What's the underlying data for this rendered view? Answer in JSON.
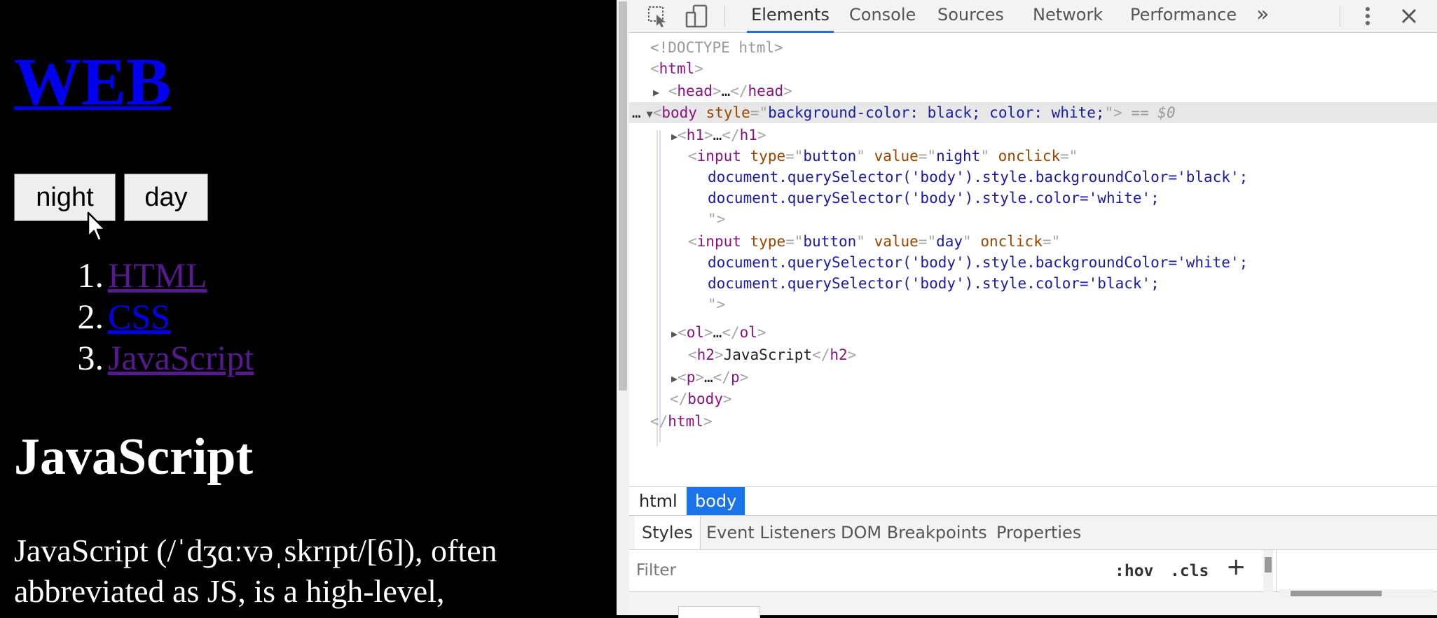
{
  "page": {
    "heading": "WEB",
    "buttons": {
      "night": "night",
      "day": "day"
    },
    "list": [
      {
        "num": "1.",
        "label": "HTML"
      },
      {
        "num": "2.",
        "label": "CSS"
      },
      {
        "num": "3.",
        "label": "JavaScript"
      }
    ],
    "subheading": "JavaScript",
    "paragraph": "JavaScript (/ˈdʒɑːvəˌskrɪpt/[6]), often abbreviated as JS, is a high-level,"
  },
  "devtools": {
    "tabs": [
      "Elements",
      "Console",
      "Sources",
      "Network",
      "Performance"
    ],
    "more": "»",
    "dom": {
      "doctype": "<!DOCTYPE html>",
      "sel_marker": "== $0",
      "body_style": "background-color: black; color: white;",
      "onclick_night_1": "document.querySelector('body').style.backgroundColor='black';",
      "onclick_night_2": "document.querySelector('body').style.color='white';",
      "onclick_day_1": "document.querySelector('body').style.backgroundColor='white';",
      "onclick_day_2": "document.querySelector('body').style.color='black';",
      "h2_text": "JavaScript"
    },
    "breadcrumbs": [
      "html",
      "body"
    ],
    "style_tabs": [
      "Styles",
      "Event Listeners",
      "DOM Breakpoints",
      "Properties"
    ],
    "filter_placeholder": "Filter",
    "hov": ":hov",
    "cls": ".cls",
    "plus": "+"
  },
  "colors": {
    "page_background": "#000000",
    "page_text": "#ffffff",
    "link_unvisited": "#0000ee",
    "link_visited": "#551a8b",
    "devtools_accent": "#1a73e8",
    "selected_row": "#e7e7e7"
  },
  "icons": [
    "cursor-pointer-icon",
    "inspect-element-icon",
    "device-toolbar-icon",
    "more-tabs-icon",
    "kebab-menu-icon",
    "close-icon",
    "expand-triangle-icon",
    "collapse-triangle-icon"
  ]
}
